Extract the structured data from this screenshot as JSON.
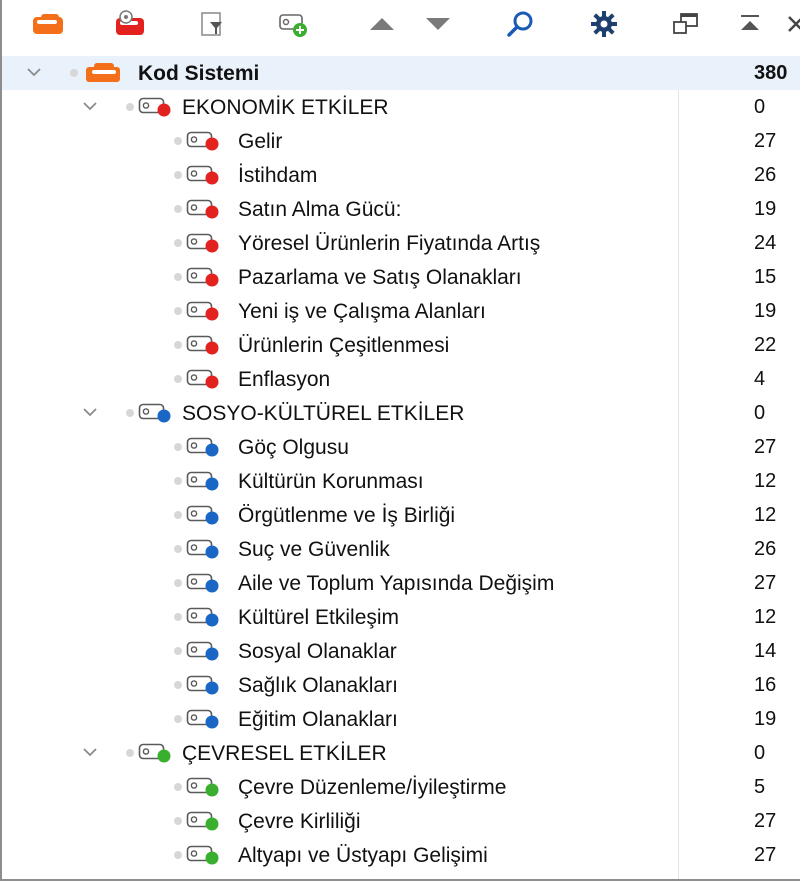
{
  "colors": {
    "economic": "#e3211f",
    "social": "#1966c7",
    "environment": "#3aae2f",
    "root_accent": "#f46f1a",
    "selection": "#e9f1fb"
  },
  "toolbar": {
    "buttons": [
      {
        "icon": "new-code-system-icon"
      },
      {
        "icon": "code-settings-icon"
      },
      {
        "icon": "filter-codes-icon"
      },
      {
        "icon": "new-code-icon"
      },
      {
        "icon": "move-up-icon"
      },
      {
        "icon": "move-down-icon"
      },
      {
        "icon": "search-icon"
      },
      {
        "icon": "gear-icon"
      },
      {
        "icon": "undock-window-icon"
      },
      {
        "icon": "collapse-icon"
      },
      {
        "icon": "close-icon"
      }
    ]
  },
  "tree": {
    "root": {
      "label": "Kod Sistemi",
      "count": "380"
    },
    "groups": [
      {
        "label": "EKONOMİK ETKİLER",
        "count": "0",
        "color": "economic",
        "items": [
          {
            "label": "Gelir",
            "count": "27"
          },
          {
            "label": "İstihdam",
            "count": "26"
          },
          {
            "label": "Satın Alma Gücü:",
            "count": "19"
          },
          {
            "label": "Yöresel Ürünlerin Fiyatında Artış",
            "count": "24"
          },
          {
            "label": "Pazarlama ve Satış Olanakları",
            "count": "15"
          },
          {
            "label": "Yeni iş ve Çalışma Alanları",
            "count": "19"
          },
          {
            "label": "Ürünlerin Çeşitlenmesi",
            "count": "22"
          },
          {
            "label": "Enflasyon",
            "count": "4"
          }
        ]
      },
      {
        "label": "SOSYO-KÜLTÜREL ETKİLER",
        "count": "0",
        "color": "social",
        "items": [
          {
            "label": "Göç Olgusu",
            "count": "27"
          },
          {
            "label": "Kültürün Korunması",
            "count": "12"
          },
          {
            "label": "Örgütlenme ve İş Birliği",
            "count": "12"
          },
          {
            "label": "Suç ve Güvenlik",
            "count": "26"
          },
          {
            "label": "Aile ve Toplum Yapısında Değişim",
            "count": "27"
          },
          {
            "label": "Kültürel Etkileşim",
            "count": "12"
          },
          {
            "label": "Sosyal Olanaklar",
            "count": "14"
          },
          {
            "label": "Sağlık Olanakları",
            "count": "16"
          },
          {
            "label": "Eğitim Olanakları",
            "count": "19"
          }
        ]
      },
      {
        "label": "ÇEVRESEL ETKİLER",
        "count": "0",
        "color": "environment",
        "items": [
          {
            "label": "Çevre Düzenleme/İyileştirme",
            "count": "5"
          },
          {
            "label": "Çevre Kirliliği",
            "count": "27"
          },
          {
            "label": "Altyapı ve Üstyapı Gelişimi",
            "count": "27"
          }
        ]
      }
    ]
  }
}
